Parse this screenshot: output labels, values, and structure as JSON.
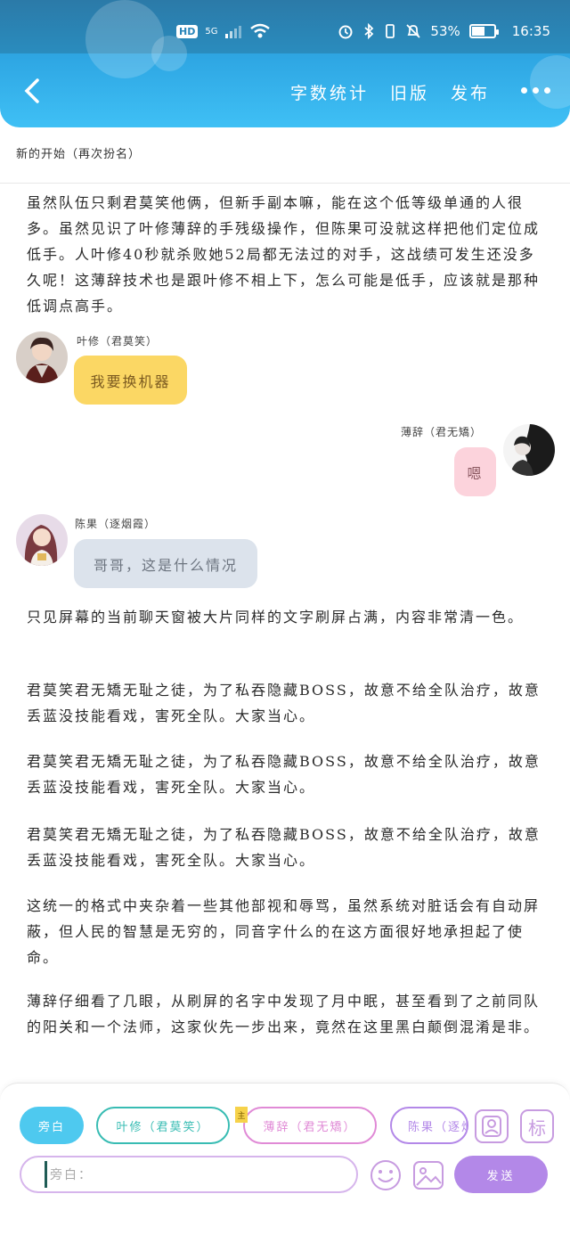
{
  "status_bar": {
    "hd": "HD",
    "net": "5G",
    "battery": "53%",
    "battery_level": 0.53,
    "time": "16:35"
  },
  "nav": {
    "links": [
      "字数统计",
      "旧版",
      "发布"
    ]
  },
  "chapter": {
    "title": "新的开始（再次扮名）"
  },
  "story": {
    "para1": "虽然队伍只剩君莫笑他俩，但新手副本嘛，能在这个低等级单通的人很多。虽然见识了叶修薄辞的手残级操作，但陈果可没就这样把他们定位成低手。人叶修40秒就杀败她52局都无法过的对手，这战绩可发生还没多久呢！这薄辞技术也是跟叶修不相上下，怎么可能是低手，应该就是那种低调点高手。",
    "msg1": {
      "speaker": "叶修（君莫笑）",
      "text": "我要换机器"
    },
    "msg2": {
      "speaker": "薄辞（君无矯）",
      "text": "嗯"
    },
    "msg3": {
      "speaker": "陈果（逐烟霞）",
      "text": "哥哥，这是什么情况"
    },
    "para2": "只见屏幕的当前聊天窗被大片同样的文字刷屏占满，内容非常清一色。",
    "para3": "君莫笑君无矯无耻之徒，为了私吞隐藏BOSS，故意不给全队治疗，故意丢蓝没技能看戏，害死全队。大家当心。",
    "para4": "君莫笑君无矯无耻之徒，为了私吞隐藏BOSS，故意不给全队治疗，故意丢蓝没技能看戏，害死全队。大家当心。",
    "para5": "君莫笑君无矯无耻之徒，为了私吞隐藏BOSS，故意不给全队治疗，故意丢蓝没技能看戏，害死全队。大家当心。",
    "para6": "这统一的格式中夹杂着一些其他部视和辱骂，虽然系统对脏话会有自动屏蔽，但人民的智慧是无穷的，同音字什么的在这方面很好地承担起了使命。",
    "para7": "薄辞仔细看了几眼，从刷屏的名字中发现了月中眠，甚至看到了之前同队的阳关和一个法师，这家伙先一步出来，竟然在这里黑白颠倒混淆是非。"
  },
  "composer": {
    "chips": [
      "旁白",
      "叶修（君莫笑）",
      "薄辞（君无矯）",
      "陈果（逐烟霞）"
    ],
    "chip_badge": "主",
    "role_button": "标",
    "input_placeholder": "旁白：",
    "send_label": "发送"
  },
  "colors": {
    "header_top": "#2a86ba",
    "header_bottom": "#3fc0f5",
    "bubble_yemo": "#fbd764",
    "bubble_boci": "#fcd3dc",
    "bubble_chenguo": "#dce3ec",
    "chip_narration": "#4ec9ef",
    "chip_yexiu": "#38bcb3",
    "chip_boci": "#e08ad6",
    "chip_chenguo": "#b388e8",
    "send_button": "#b388e8"
  }
}
